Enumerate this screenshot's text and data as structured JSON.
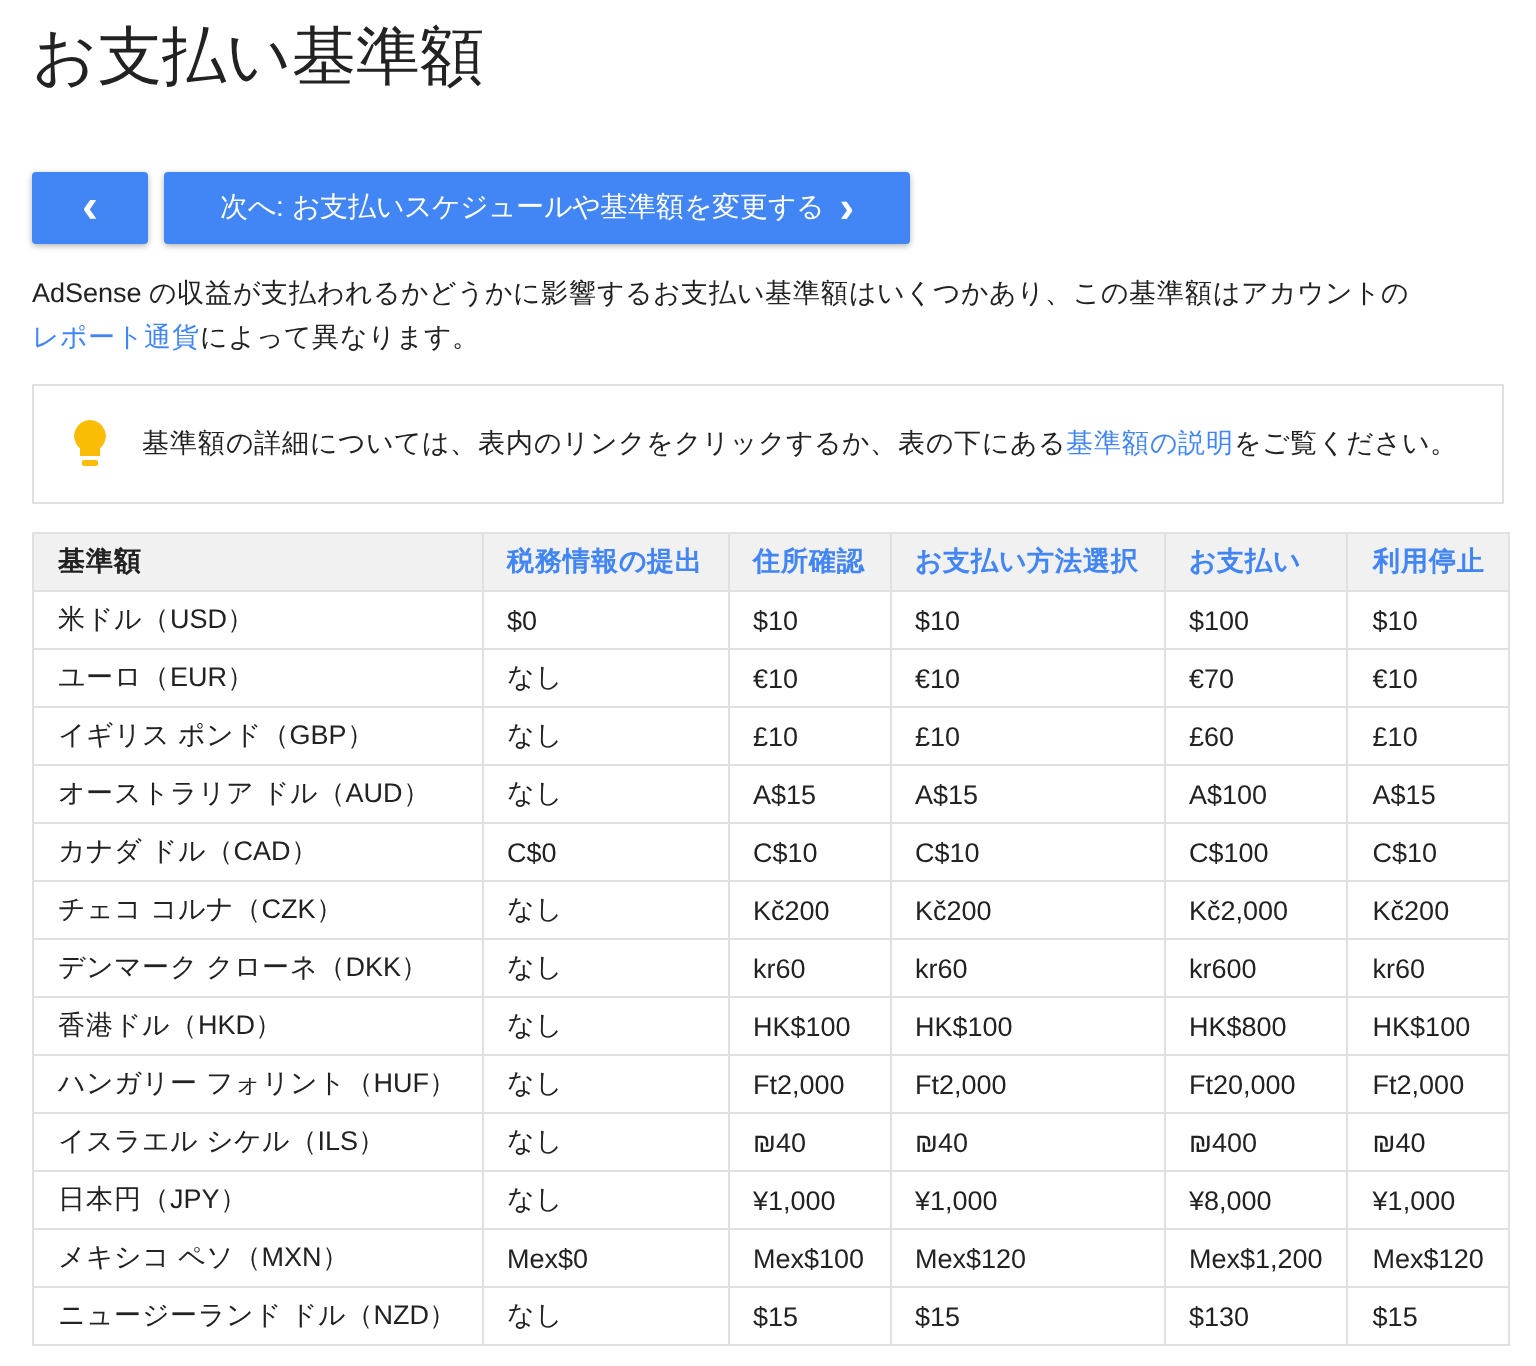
{
  "page_title": "お支払い基準額",
  "nav": {
    "back_button": "‹",
    "next_button": "次へ: お支払いスケジュールや基準額を変更する",
    "next_chevron": "›"
  },
  "intro": {
    "before": "AdSense の収益が支払われるかどうかに影響するお支払い基準額はいくつかあり、この基準額はアカウントの",
    "link": "レポート通貨",
    "after": "によって異なります。"
  },
  "note": {
    "before": "基準額の詳細については、表内のリンクをクリックするか、表の下にある",
    "link": "基準額の説明",
    "after": "をご覧ください。"
  },
  "table": {
    "columns": [
      {
        "label": "基準額",
        "kind": "text"
      },
      {
        "label": "税務情報の提出",
        "kind": "link"
      },
      {
        "label": "住所確認",
        "kind": "link"
      },
      {
        "label": "お支払い方法選択",
        "kind": "link"
      },
      {
        "label": "お支払い",
        "kind": "link"
      },
      {
        "label": "利用停止",
        "kind": "link"
      }
    ],
    "rows": [
      [
        "米ドル（USD）",
        "$0",
        "$10",
        "$10",
        "$100",
        "$10"
      ],
      [
        "ユーロ（EUR）",
        "なし",
        "€10",
        "€10",
        "€70",
        "€10"
      ],
      [
        "イギリス ポンド（GBP）",
        "なし",
        "£10",
        "£10",
        "£60",
        "£10"
      ],
      [
        "オーストラリア ドル（AUD）",
        "なし",
        "A$15",
        "A$15",
        "A$100",
        "A$15"
      ],
      [
        "カナダ ドル（CAD）",
        "C$0",
        "C$10",
        "C$10",
        "C$100",
        "C$10"
      ],
      [
        "チェコ コルナ（CZK）",
        "なし",
        "Kč200",
        "Kč200",
        "Kč2,000",
        "Kč200"
      ],
      [
        "デンマーク クローネ（DKK）",
        "なし",
        "kr60",
        "kr60",
        "kr600",
        "kr60"
      ],
      [
        "香港ドル（HKD）",
        "なし",
        "HK$100",
        "HK$100",
        "HK$800",
        "HK$100"
      ],
      [
        "ハンガリー フォリント（HUF）",
        "なし",
        "Ft2,000",
        "Ft2,000",
        "Ft20,000",
        "Ft2,000"
      ],
      [
        "イスラエル シケル（ILS）",
        "なし",
        "₪40",
        "₪40",
        "₪400",
        "₪40"
      ],
      [
        "日本円（JPY）",
        "なし",
        "¥1,000",
        "¥1,000",
        "¥8,000",
        "¥1,000"
      ],
      [
        "メキシコ ペソ（MXN）",
        "Mex$0",
        "Mex$100",
        "Mex$120",
        "Mex$1,200",
        "Mex$120"
      ],
      [
        "ニュージーランド ドル（NZD）",
        "なし",
        "$15",
        "$15",
        "$130",
        "$15"
      ]
    ]
  }
}
